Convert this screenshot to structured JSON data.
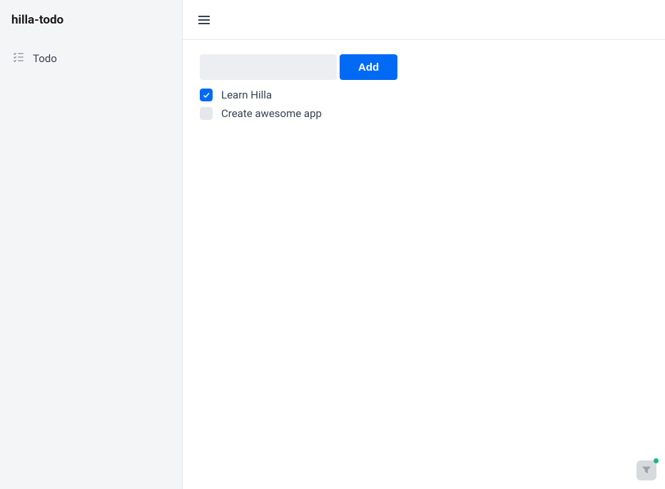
{
  "app": {
    "title": "hilla-todo"
  },
  "sidebar": {
    "items": [
      {
        "label": "Todo"
      }
    ]
  },
  "main": {
    "input_value": "",
    "add_label": "Add",
    "todos": [
      {
        "label": "Learn Hilla",
        "done": true
      },
      {
        "label": "Create awesome app",
        "done": false
      }
    ]
  }
}
